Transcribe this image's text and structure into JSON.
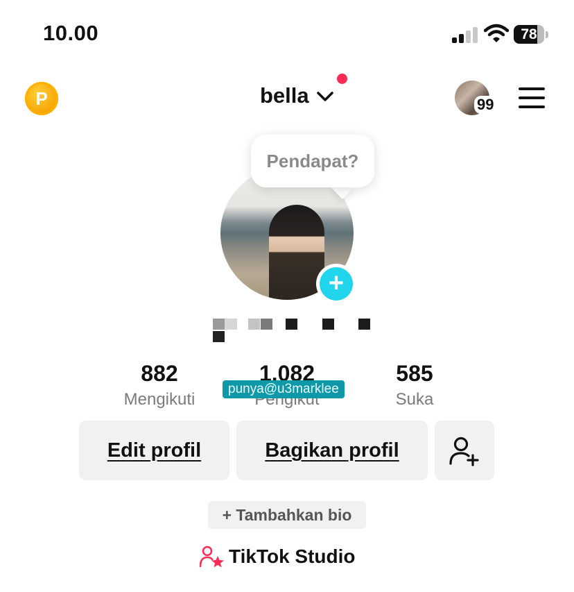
{
  "status_bar": {
    "time": "10.00",
    "battery_text": "78",
    "battery_level": 0.78,
    "signal_bars_active": 2,
    "signal_bars_total": 4
  },
  "header": {
    "coin_letter": "P",
    "username": "bella",
    "story_count": "99",
    "notification_color": "#fe2c55"
  },
  "profile": {
    "tooltip": "Pendapat?",
    "watermark": "punya@u3marklee"
  },
  "stats": [
    {
      "value": "882",
      "label": "Mengikuti"
    },
    {
      "value": "1.082",
      "label": "Pengikut"
    },
    {
      "value": "585",
      "label": "Suka"
    }
  ],
  "actions": {
    "edit_profile": "Edit profil",
    "share_profile": "Bagikan profil"
  },
  "bio": {
    "add_bio": "+ Tambahkan bio"
  },
  "studio": {
    "label": "TikTok Studio"
  },
  "colors": {
    "accent_pink": "#fe2c55",
    "accent_cyan": "#20d5ec",
    "coin_gold": "#f6a400"
  }
}
